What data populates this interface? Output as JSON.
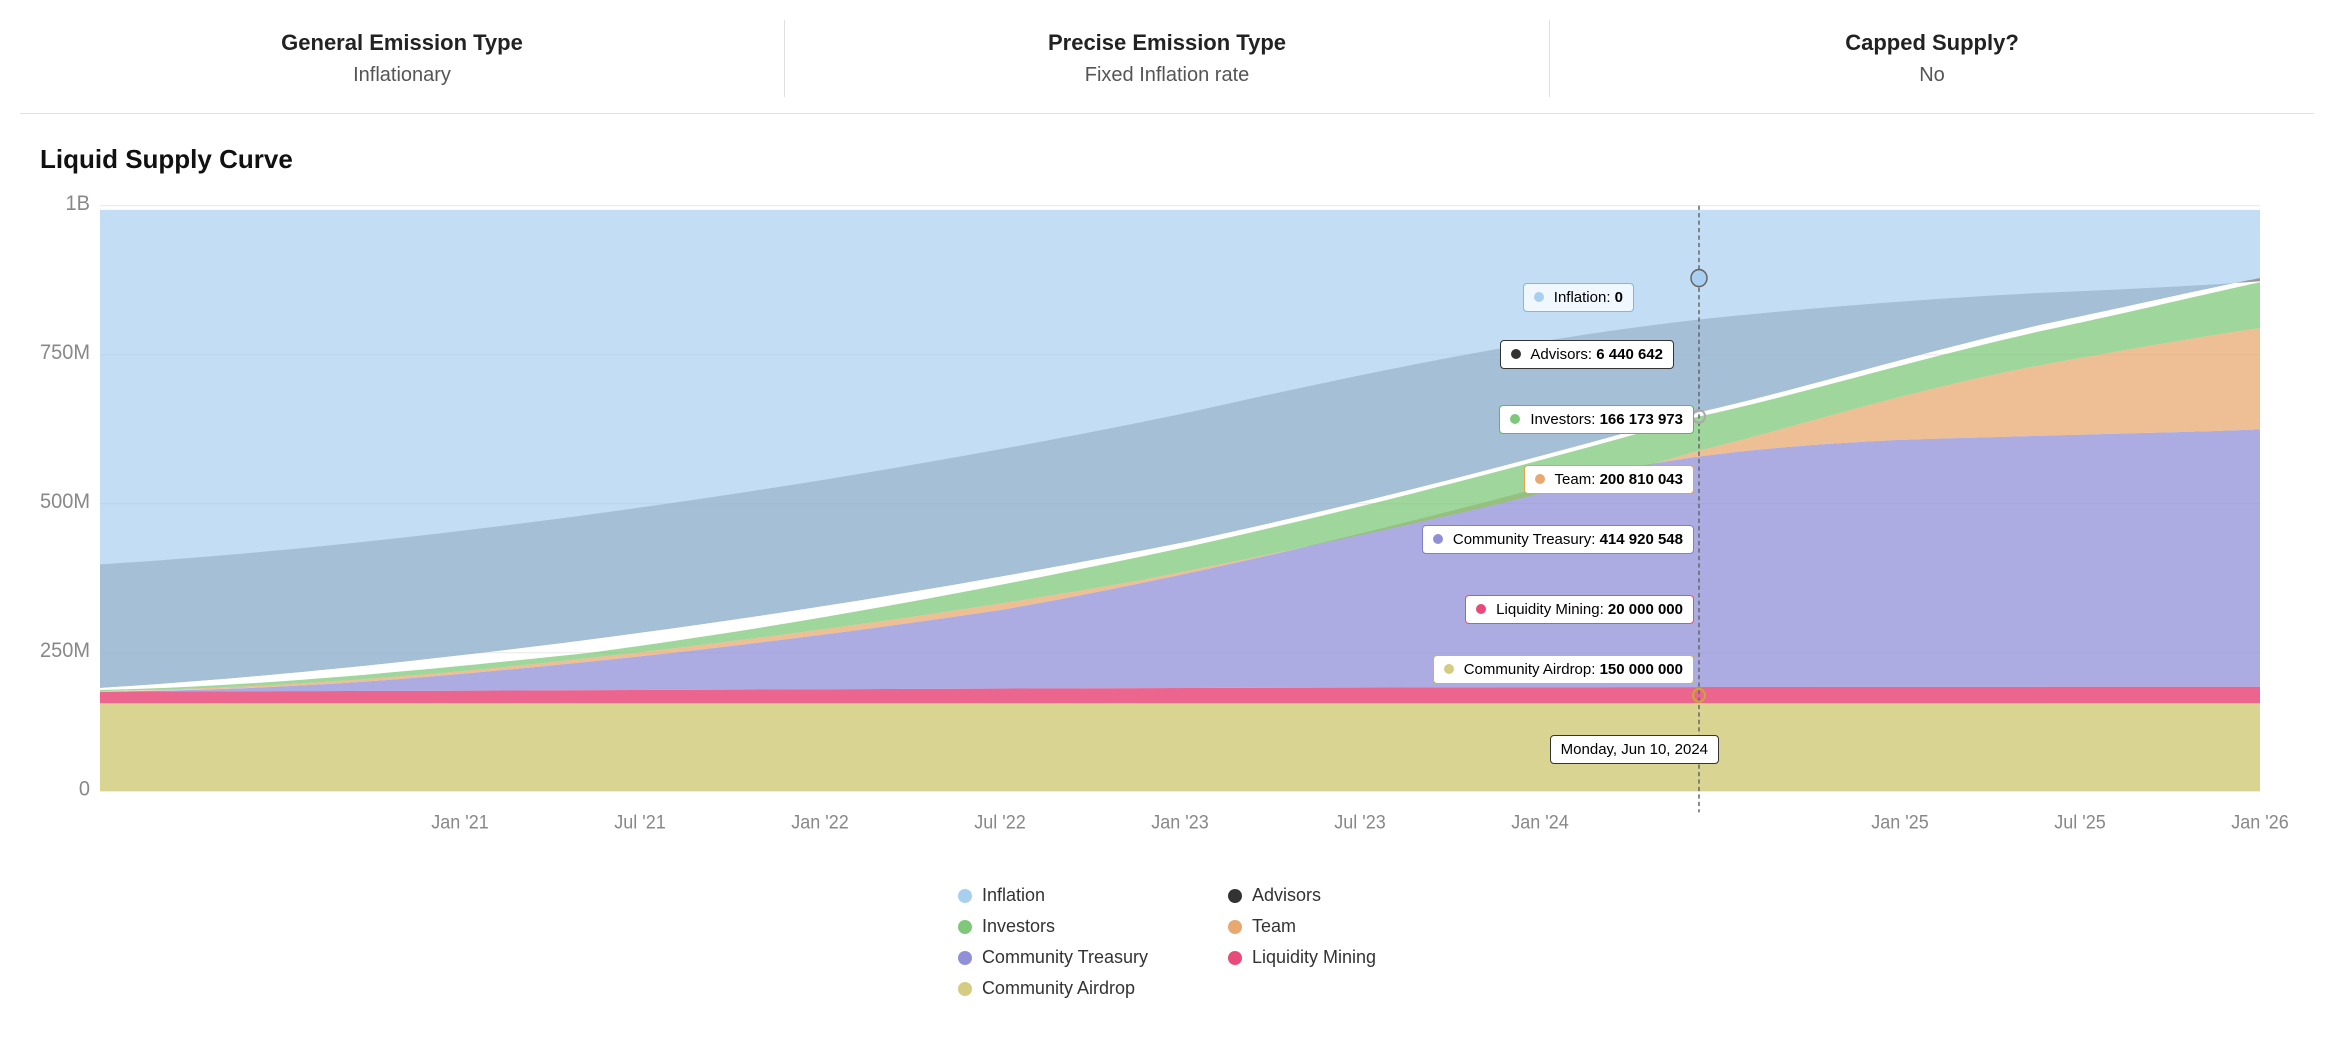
{
  "header": {
    "cols": [
      {
        "label": "General Emission Type",
        "value": "Inflationary"
      },
      {
        "label": "Precise Emission Type",
        "value": "Fixed Inflation rate"
      },
      {
        "label": "Capped Supply?",
        "value": "No"
      }
    ]
  },
  "chart": {
    "title": "Liquid Supply Curve",
    "y_labels": [
      "0",
      "250M",
      "500M",
      "750M",
      "1B"
    ],
    "x_labels": [
      "Jan '21",
      "Jul '21",
      "Jan '22",
      "Jul '22",
      "Jan '23",
      "Jul '23",
      "Jan '24",
      "Jan '25",
      "Jul '25",
      "Jan '26"
    ],
    "cursor_date": "Monday, Jun 10, 2024",
    "tooltips": [
      {
        "id": "inflation",
        "label": "Inflation",
        "value": "0",
        "color": "#7eb8e8",
        "border": "blue-border"
      },
      {
        "id": "advisors",
        "label": "Advisors",
        "value": "6 440 642",
        "color": "#333",
        "border": "dark-border"
      },
      {
        "id": "investors",
        "label": "Investors",
        "value": "166 173 973",
        "color": "#5cb85c",
        "border": "green-border"
      },
      {
        "id": "team",
        "label": "Team",
        "value": "200 810 043",
        "color": "#e8a04a",
        "border": "orange-border"
      },
      {
        "id": "community_treasury",
        "label": "Community Treasury",
        "value": "414 920 548",
        "color": "#8080cc",
        "border": "purple-border"
      },
      {
        "id": "liquidity_mining",
        "label": "Liquidity Mining",
        "value": "20 000 000",
        "color": "#e84a7a",
        "border": "pink-border"
      },
      {
        "id": "community_airdrop",
        "label": "Community Airdrop",
        "value": "150 000 000",
        "color": "#c8b84a",
        "border": "yellow-border"
      }
    ],
    "legend": [
      {
        "label": "Inflation",
        "color": "#a8cff0"
      },
      {
        "label": "Advisors",
        "color": "#333"
      },
      {
        "label": "Investors",
        "color": "#7fc87a"
      },
      {
        "label": "Team",
        "color": "#e8a870"
      },
      {
        "label": "Community Treasury",
        "color": "#9090d8"
      },
      {
        "label": "Liquidity Mining",
        "color": "#e84a7a"
      },
      {
        "label": "Community Airdrop",
        "color": "#d4cc80"
      }
    ]
  }
}
